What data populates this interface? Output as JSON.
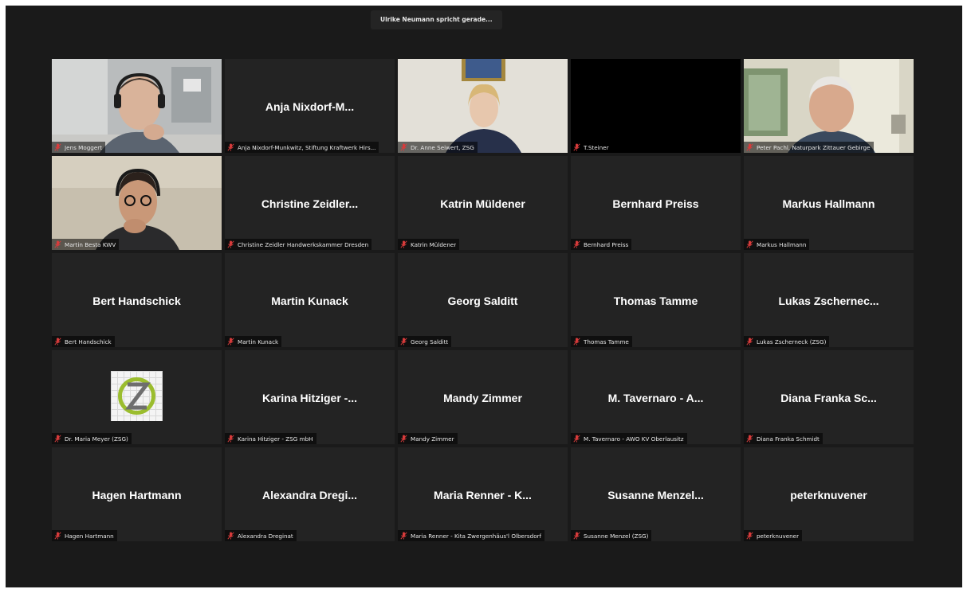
{
  "banner": {
    "speaking_text": "Ulrike Neumann spricht gerade..."
  },
  "colors": {
    "muted_icon": "#d83b3b",
    "tile_bg": "#232323",
    "window_bg": "#1a1a1a"
  },
  "icons": {
    "muted": "muted-mic-icon"
  },
  "participants": [
    {
      "label": "Jens Moggert",
      "name": ""
    },
    {
      "label": "Anja Nixdorf-Munkwitz, Stiftung Kraftwerk Hirs...",
      "name": "Anja  Nixdorf-M..."
    },
    {
      "label": "Dr. Anne Seiwert, ZSG",
      "name": ""
    },
    {
      "label": "T.Steiner",
      "name": ""
    },
    {
      "label": "Peter Pachl, Naturpark Zittauer Gebirge",
      "name": ""
    },
    {
      "label": "Martin Besta KWV",
      "name": ""
    },
    {
      "label": "Christine Zeidler Handwerkskammer Dresden",
      "name": "Christine  Zeidler..."
    },
    {
      "label": "Katrin Müldener",
      "name": "Katrin Müldener"
    },
    {
      "label": "Bernhard Preiss",
      "name": "Bernhard Preiss"
    },
    {
      "label": "Markus Hallmann",
      "name": "Markus Hallmann"
    },
    {
      "label": "Bert Handschick",
      "name": "Bert Handschick"
    },
    {
      "label": "Martin Kunack",
      "name": "Martin Kunack"
    },
    {
      "label": "Georg Salditt",
      "name": "Georg Salditt"
    },
    {
      "label": "Thomas Tamme",
      "name": "Thomas Tamme"
    },
    {
      "label": "Lukas Zscherneck (ZSG)",
      "name": "Lukas  Zschernec..."
    },
    {
      "label": "Dr. Maria Meyer (ZSG)",
      "name": ""
    },
    {
      "label": "Karina Hitziger - ZSG mbH",
      "name": "Karina  Hitziger  -..."
    },
    {
      "label": "Mandy Zimmer",
      "name": "Mandy Zimmer"
    },
    {
      "label": "M. Tavernaro - AWO KV Oberlausitz",
      "name": "M.  Tavernaro  -  A..."
    },
    {
      "label": "Diana Franka Schmidt",
      "name": "Diana  Franka  Sc..."
    },
    {
      "label": "Hagen Hartmann",
      "name": "Hagen Hartmann"
    },
    {
      "label": "Alexandra Dreginat",
      "name": "Alexandra  Dregi..."
    },
    {
      "label": "Maria Renner - Kita Zwergenhäus'l Olbersdorf",
      "name": "Maria  Renner  -  K..."
    },
    {
      "label": "Susanne Menzel (ZSG)",
      "name": "Susanne  Menzel..."
    },
    {
      "label": "peterknuvener",
      "name": "peterknuvener"
    }
  ]
}
